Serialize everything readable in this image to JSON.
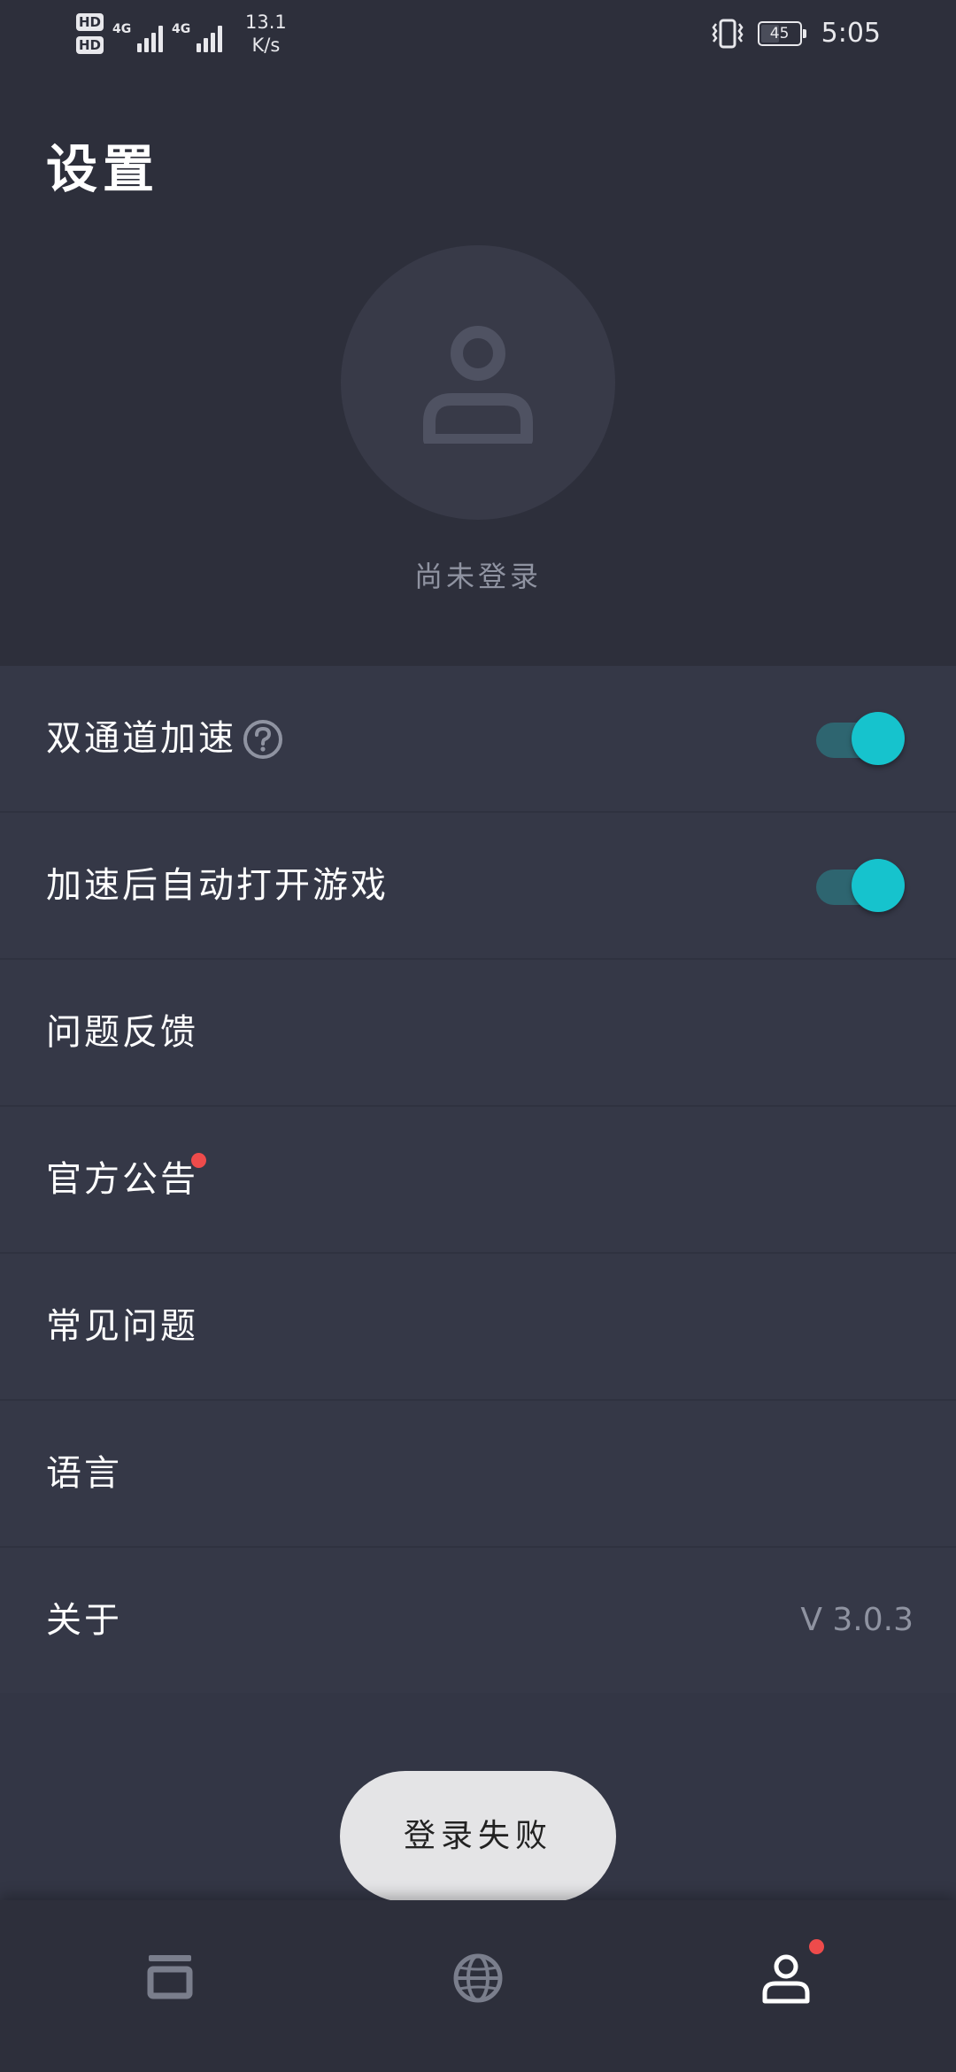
{
  "status_bar": {
    "sim1_label": "HD",
    "sim2_label": "HD",
    "network1": "4G",
    "network2": "4G",
    "net_speed_value": "13.1",
    "net_speed_unit": "K/s",
    "battery_level": "45",
    "time": "5:05",
    "icons": [
      "hd-badge-icon",
      "signal-icon",
      "vibrate-icon",
      "battery-icon"
    ]
  },
  "header": {
    "title": "设置",
    "avatar_icon": "user-icon",
    "login_status": "尚未登录"
  },
  "settings": {
    "dual_channel": {
      "label": "双通道加速",
      "enabled": true,
      "help_icon": "help-icon"
    },
    "auto_open_game": {
      "label": "加速后自动打开游戏",
      "enabled": true
    },
    "feedback": {
      "label": "问题反馈"
    },
    "announcement": {
      "label": "官方公告",
      "has_notification": true
    },
    "faq": {
      "label": "常见问题"
    },
    "language": {
      "label": "语言"
    },
    "about": {
      "label": "关于",
      "version": "V 3.0.3"
    }
  },
  "toast": {
    "message": "登录失败"
  },
  "bottom_nav": {
    "items": [
      {
        "icon": "games-icon",
        "active": false
      },
      {
        "icon": "globe-icon",
        "active": false
      },
      {
        "icon": "profile-icon",
        "active": true,
        "has_notification": true
      }
    ]
  },
  "colors": {
    "background": "#333645",
    "header_bg": "#2d2f3b",
    "accent": "#16c3cd",
    "toggle_track": "#2e6570",
    "badge_red": "#ee4b4b",
    "muted_text": "#8f93a1"
  }
}
